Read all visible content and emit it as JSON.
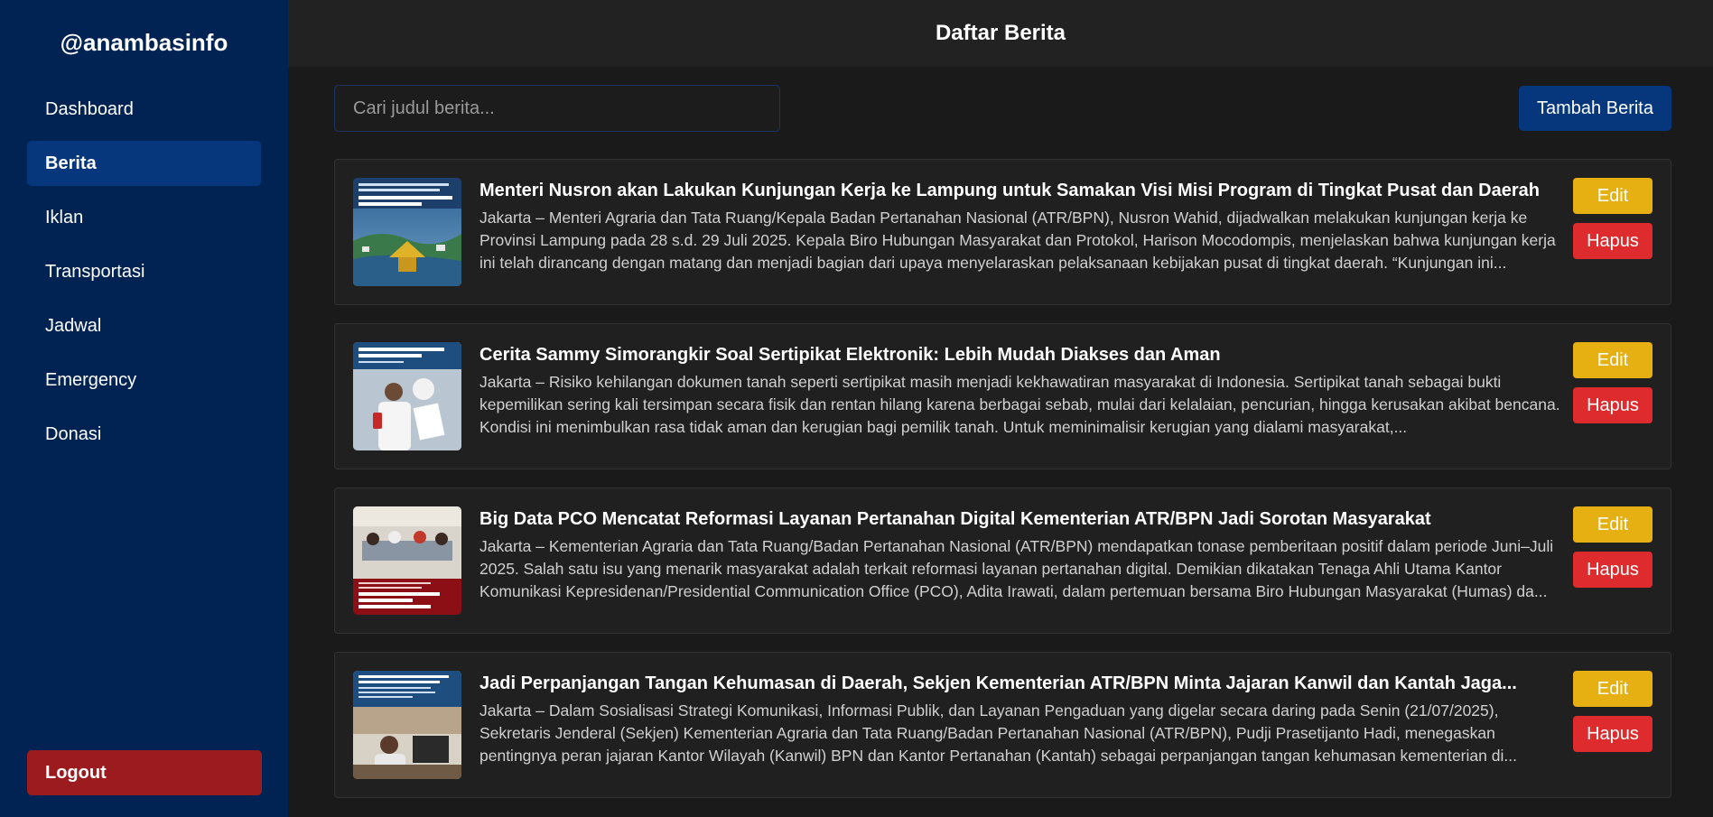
{
  "sidebar": {
    "brand": "@anambasinfo",
    "items": [
      {
        "label": "Dashboard"
      },
      {
        "label": "Berita"
      },
      {
        "label": "Iklan"
      },
      {
        "label": "Transportasi"
      },
      {
        "label": "Jadwal"
      },
      {
        "label": "Emergency"
      },
      {
        "label": "Donasi"
      }
    ],
    "active": "Berita",
    "logout_label": "Logout"
  },
  "header": {
    "title": "Daftar Berita"
  },
  "toolbar": {
    "search_placeholder": "Cari judul berita...",
    "add_label": "Tambah Berita"
  },
  "actions": {
    "edit_label": "Edit",
    "delete_label": "Hapus"
  },
  "news": [
    {
      "title": "Menteri Nusron akan Lakukan Kunjungan Kerja ke Lampung untuk Samakan Visi Misi Program di Tingkat Pusat dan Daerah",
      "excerpt": "Jakarta – Menteri Agraria dan Tata Ruang/Kepala Badan Pertanahan Nasional (ATR/BPN), Nusron Wahid, dijadwalkan melakukan kunjungan kerja ke Provinsi Lampung pada 28 s.d. 29 Juli 2025. Kepala Biro Hubungan Masyarakat dan Protokol, Harison Mocodompis, menjelaskan bahwa kunjungan kerja ini telah dirancang dengan matang dan menjadi bagian dari upaya menyelaraskan pelaksanaan kebijakan pusat di tingkat daerah. “Kunjungan ini...",
      "thumb_caption": "Samakan Visi Misi Program di Tingkat Pusat dan Daerah"
    },
    {
      "title": "Cerita Sammy Simorangkir Soal Sertipikat Elektronik: Lebih Mudah Diakses dan Aman",
      "excerpt": "Jakarta – Risiko kehilangan dokumen tanah seperti sertipikat masih menjadi kekhawatiran masyarakat di Indonesia. Sertipikat tanah sebagai bukti kepemilikan sering kali tersimpan secara fisik dan rentan hilang karena berbagai sebab, mulai dari kelalaian, pencurian, hingga kerusakan akibat bencana. Kondisi ini menimbulkan rasa tidak aman dan kerugian bagi pemilik tanah. Untuk meminimalisir kerugian yang dialami masyarakat,...",
      "thumb_caption": "Cerita Sammy Simorangkir Soal Sertipikat Elektronik"
    },
    {
      "title": "Big Data PCO Mencatat Reformasi Layanan Pertanahan Digital Kementerian ATR/BPN Jadi Sorotan Masyarakat",
      "excerpt": "Jakarta – Kementerian Agraria dan Tata Ruang/Badan Pertanahan Nasional (ATR/BPN) mendapatkan tonase pemberitaan positif dalam periode Juni–Juli 2025. Salah satu isu yang menarik masyarakat adalah terkait reformasi layanan pertanahan digital. Demikian dikatakan Tenaga Ahli Utama Kantor Komunikasi Kepresidenan/Presidential Communication Office (PCO), Adita Irawati, dalam pertemuan bersama Biro Hubungan Masyarakat (Humas) da...",
      "thumb_caption": "Kementerian ATR/BPN Jadi Sorotan Masyarakat"
    },
    {
      "title": "Jadi Perpanjangan Tangan Kehumasan di Daerah, Sekjen Kementerian ATR/BPN Minta Jajaran Kanwil dan Kantah Jaga...",
      "excerpt": "Jakarta – Dalam Sosialisasi Strategi Komunikasi, Informasi Publik, dan Layanan Pengaduan yang digelar secara daring pada Senin (21/07/2025), Sekretaris Jenderal (Sekjen) Kementerian Agraria dan Tata Ruang/Badan Pertanahan Nasional (ATR/BPN), Pudji Prasetijanto Hadi, menegaskan pentingnya peran jajaran Kantor Wilayah (Kanwil) BPN dan Kantor Pertanahan (Kantah) sebagai perpanjangan tangan kehumasan kementerian di...",
      "thumb_caption": "Jadi Perpanjangan Tangan Kehumasan di Daerah"
    }
  ]
}
